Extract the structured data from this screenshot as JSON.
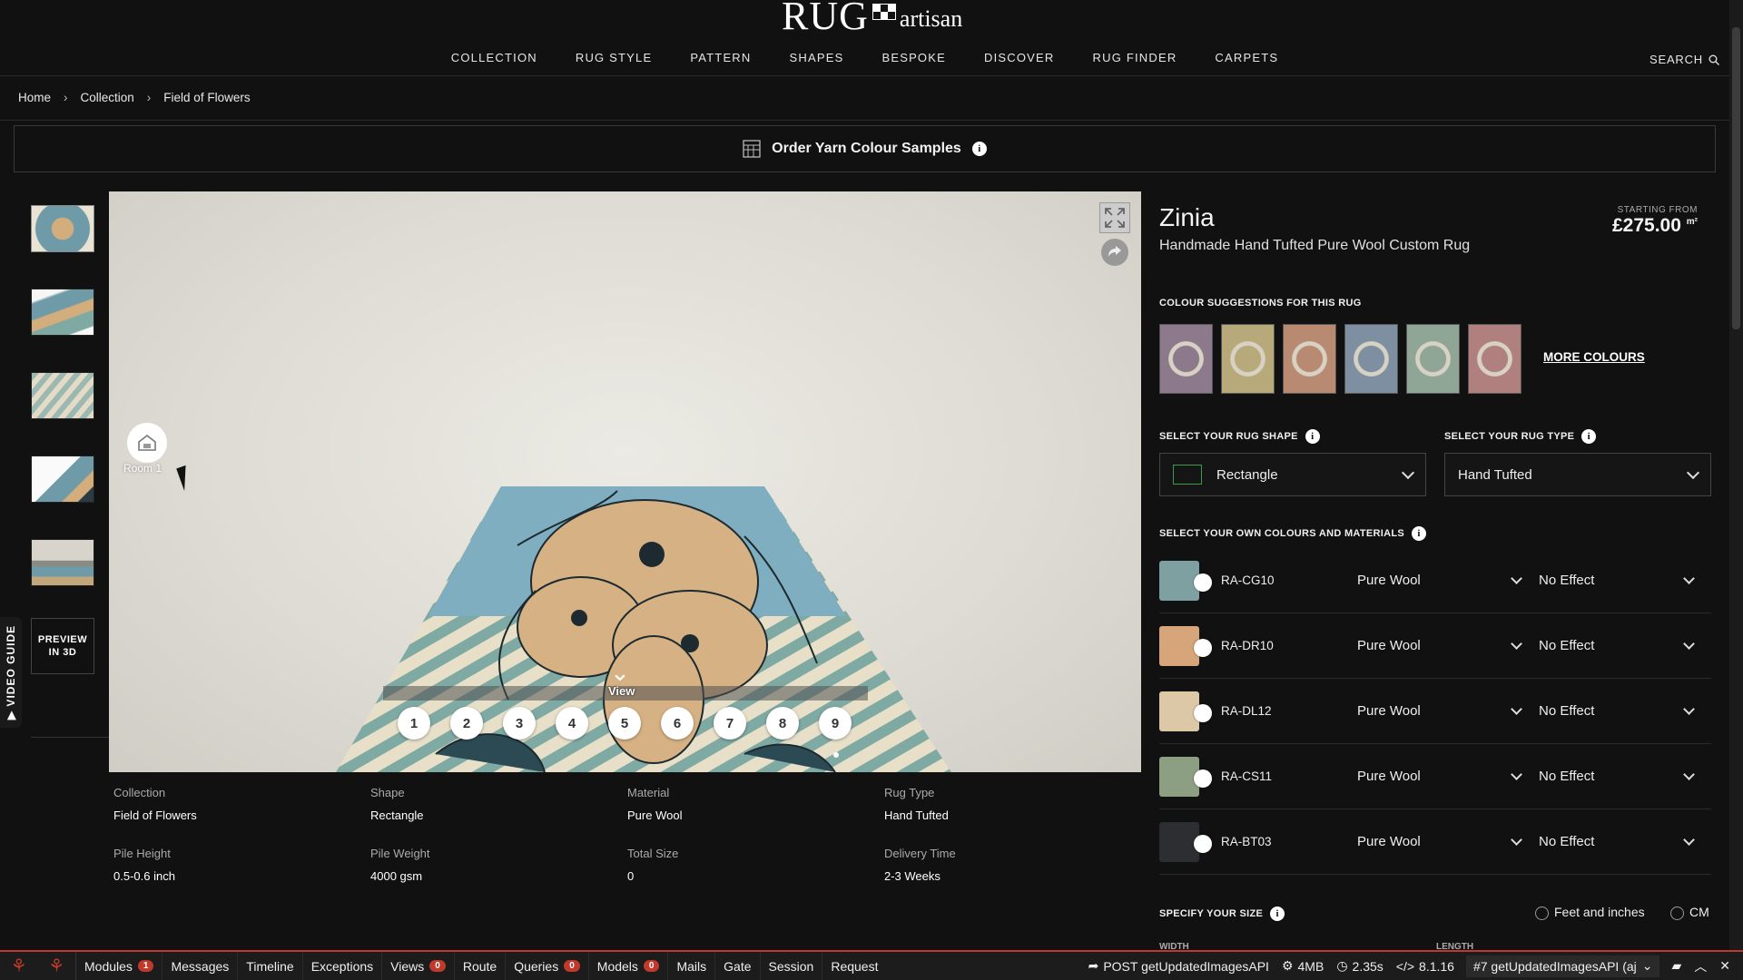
{
  "brand": {
    "logo_main": "RUG",
    "logo_sub": "artisan"
  },
  "nav": [
    "COLLECTION",
    "RUG STYLE",
    "PATTERN",
    "SHAPES",
    "BESPOKE",
    "DISCOVER",
    "RUG FINDER",
    "CARPETS"
  ],
  "search_label": "SEARCH",
  "breadcrumb": [
    "Home",
    "Collection",
    "Field of Flowers"
  ],
  "yarn_bar": {
    "label": "Order Yarn Colour Samples"
  },
  "thumbs": [
    "thumb-1",
    "thumb-2",
    "thumb-3",
    "thumb-4",
    "thumb-5"
  ],
  "preview3d": {
    "line1": "PREVIEW",
    "line2": "IN 3D"
  },
  "video_guide": "▶ VIDEO GUIDE",
  "viewer": {
    "room_label": "Room 1",
    "view_label": "View",
    "views": [
      "1",
      "2",
      "3",
      "4",
      "5",
      "6",
      "7",
      "8",
      "9"
    ]
  },
  "specs": [
    {
      "k": "Collection",
      "v": "Field of Flowers"
    },
    {
      "k": "Shape",
      "v": "Rectangle"
    },
    {
      "k": "Material",
      "v": "Pure Wool"
    },
    {
      "k": "Rug Type",
      "v": "Hand Tufted"
    },
    {
      "k": "Pile Height",
      "v": "0.5-0.6 inch"
    },
    {
      "k": "Pile Weight",
      "v": "4000 gsm"
    },
    {
      "k": "Total Size",
      "v": "0"
    },
    {
      "k": "Delivery Time",
      "v": "2-3 Weeks"
    }
  ],
  "product": {
    "title": "Zinia",
    "subtitle": "Handmade Hand Tufted Pure Wool Custom Rug",
    "starting_from": "STARTING FROM",
    "price": "£275.00",
    "unit": "m²"
  },
  "colour_suggestions": {
    "heading": "COLOUR SUGGESTIONS FOR THIS RUG",
    "swatches": [
      "#8c7a8c",
      "#b7a97a",
      "#b98a72",
      "#7d8fa0",
      "#8fa596",
      "#b0807f"
    ],
    "more_label": "MORE COLOURS"
  },
  "shape_select": {
    "heading": "SELECT YOUR RUG SHAPE",
    "value": "Rectangle"
  },
  "type_select": {
    "heading": "SELECT YOUR RUG TYPE",
    "value": "Hand Tufted"
  },
  "materials": {
    "heading": "SELECT YOUR OWN COLOURS AND MATERIALS",
    "rows": [
      {
        "code": "RA-CG10",
        "color": "#7fa0a0",
        "material": "Pure Wool",
        "effect": "No Effect"
      },
      {
        "code": "RA-DR10",
        "color": "#d6a57a",
        "material": "Pure Wool",
        "effect": "No Effect"
      },
      {
        "code": "RA-DL12",
        "color": "#dcc8a6",
        "material": "Pure Wool",
        "effect": "No Effect"
      },
      {
        "code": "RA-CS11",
        "color": "#8c9f82",
        "material": "Pure Wool",
        "effect": "No Effect"
      },
      {
        "code": "RA-BT03",
        "color": "#2c2e31",
        "material": "Pure Wool",
        "effect": "No Effect"
      }
    ]
  },
  "size": {
    "heading": "SPECIFY YOUR SIZE",
    "opt_feet": "Feet and inches",
    "opt_cm": "CM",
    "width_label": "WIDTH",
    "length_label": "LENGTH"
  },
  "debugbar": {
    "items": [
      {
        "label": "Modules",
        "badge": "1"
      },
      {
        "label": "Messages",
        "badge": ""
      },
      {
        "label": "Timeline",
        "badge": ""
      },
      {
        "label": "Exceptions",
        "badge": ""
      },
      {
        "label": "Views",
        "badge": "0"
      },
      {
        "label": "Route",
        "badge": ""
      },
      {
        "label": "Queries",
        "badge": "0"
      },
      {
        "label": "Models",
        "badge": "0"
      },
      {
        "label": "Mails",
        "badge": ""
      },
      {
        "label": "Gate",
        "badge": ""
      },
      {
        "label": "Session",
        "badge": ""
      },
      {
        "label": "Request",
        "badge": ""
      }
    ],
    "request": "POST getUpdatedImagesAPI",
    "memory": "4MB",
    "time": "2.35s",
    "php": "8.1.16",
    "selector": "#7 getUpdatedImagesAPI (aj"
  }
}
